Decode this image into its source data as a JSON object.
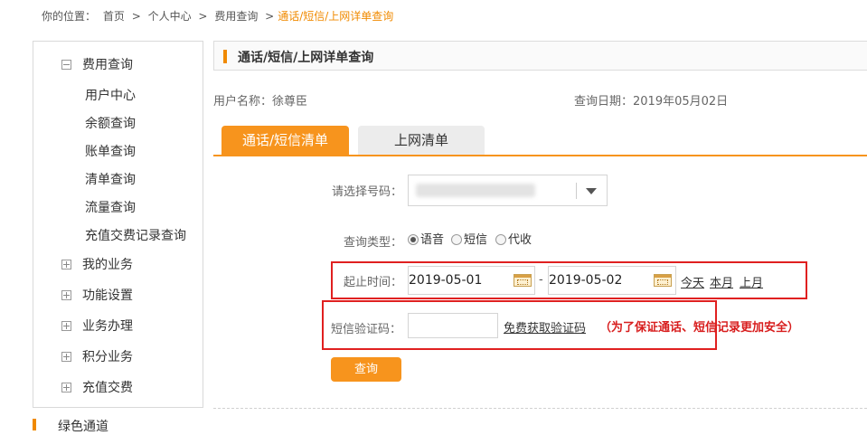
{
  "breadcrumb": {
    "prefix": "你的位置：",
    "items": [
      "首页",
      ">",
      "个人中心",
      ">",
      "费用查询",
      ">"
    ],
    "current": "通话/短信/上网详单查询"
  },
  "sidebar": {
    "groups": [
      {
        "label": "费用查询",
        "expanded": true,
        "children": [
          "用户中心",
          "余额查询",
          "账单查询",
          "清单查询",
          "流量查询",
          "充值交费记录查询"
        ]
      },
      {
        "label": "我的业务",
        "expanded": false
      },
      {
        "label": "功能设置",
        "expanded": false
      },
      {
        "label": "业务办理",
        "expanded": false
      },
      {
        "label": "积分业务",
        "expanded": false
      },
      {
        "label": "充值交费",
        "expanded": false
      }
    ],
    "footer": "绿色通道"
  },
  "panel": {
    "title": "通话/短信/上网详单查询",
    "user_label": "用户名称：",
    "user_name": "徐尊臣",
    "date_label": "查询日期：",
    "date_value": "2019年05月02日"
  },
  "tabs": [
    {
      "label": "通话/短信清单",
      "active": true
    },
    {
      "label": "上网清单",
      "active": false
    }
  ],
  "form": {
    "number_label": "请选择号码：",
    "type_label": "查询类型：",
    "types": [
      {
        "label": "语音",
        "checked": true
      },
      {
        "label": "短信",
        "checked": false
      },
      {
        "label": "代收",
        "checked": false
      }
    ],
    "time_label": "起止时间：",
    "start_date": "2019-05-01",
    "separator": "-",
    "end_date": "2019-05-02",
    "quick_links": [
      "今天",
      "本月",
      "上月"
    ],
    "sms_label": "短信验证码：",
    "sms_value": "",
    "sms_link": "免费获取验证码",
    "sms_note": "（为了保证通话、短信记录更加安全）",
    "submit": "查询"
  },
  "colors": {
    "accent": "#f7941d",
    "highlight_box": "#e02020",
    "note": "#d81e1e"
  }
}
